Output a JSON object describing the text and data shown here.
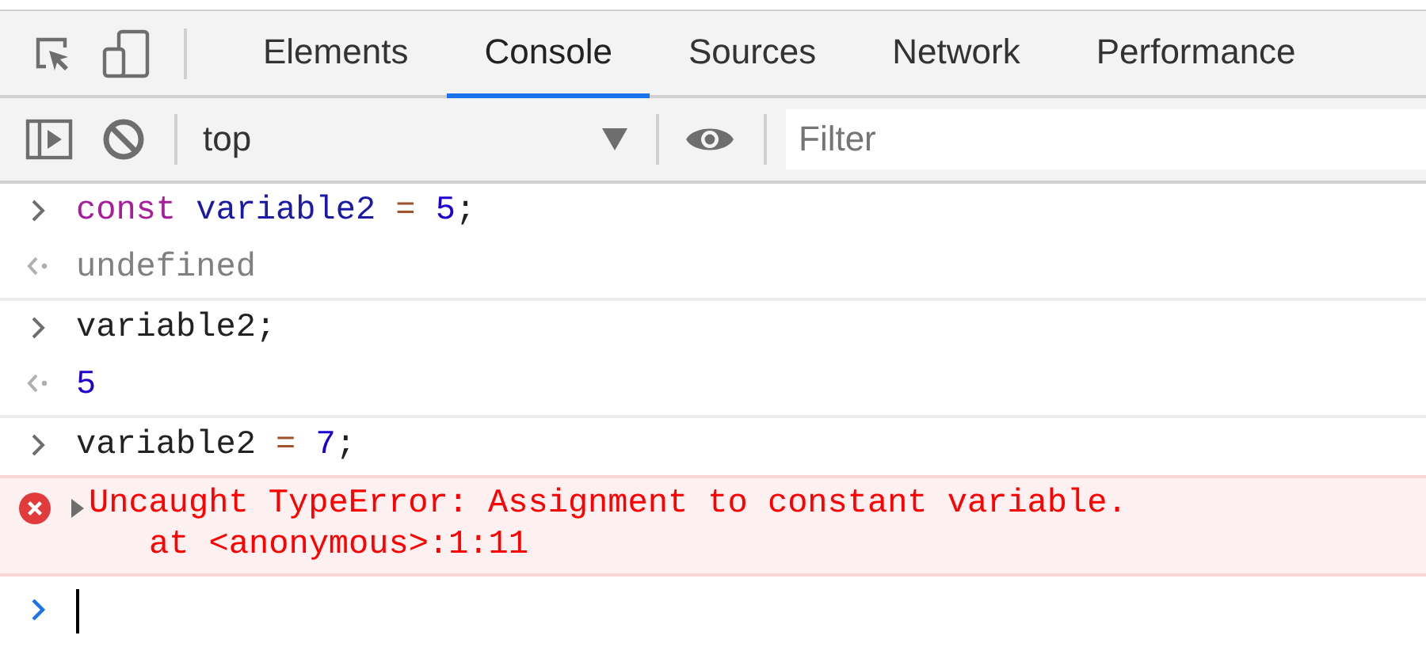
{
  "tabs": [
    {
      "label": "Elements",
      "selected": false
    },
    {
      "label": "Console",
      "selected": true
    },
    {
      "label": "Sources",
      "selected": false
    },
    {
      "label": "Network",
      "selected": false
    },
    {
      "label": "Performance",
      "selected": false
    }
  ],
  "console_toolbar": {
    "context": "top",
    "filter": {
      "placeholder": "Filter"
    }
  },
  "entries": [
    {
      "kind": "input",
      "tokens": [
        {
          "kind": "keyword",
          "text": "const "
        },
        {
          "kind": "variable",
          "text": "variable2 "
        },
        {
          "kind": "operator",
          "text": "= "
        },
        {
          "kind": "number",
          "text": "5"
        },
        {
          "kind": "plain",
          "text": ";"
        }
      ]
    },
    {
      "kind": "result",
      "tokens": [
        {
          "kind": "undefined",
          "text": "undefined"
        }
      ]
    },
    {
      "kind": "input",
      "tokens": [
        {
          "kind": "plain",
          "text": "variable2;"
        }
      ]
    },
    {
      "kind": "result",
      "tokens": [
        {
          "kind": "number",
          "text": "5"
        }
      ]
    },
    {
      "kind": "input",
      "tokens": [
        {
          "kind": "plain",
          "text": "variable2 "
        },
        {
          "kind": "operator",
          "text": "= "
        },
        {
          "kind": "number",
          "text": "7"
        },
        {
          "kind": "plain",
          "text": ";"
        }
      ]
    },
    {
      "kind": "error",
      "expanded": false,
      "message": "Uncaught TypeError: Assignment to constant variable.",
      "trace": "at <anonymous>:1:11"
    }
  ]
}
